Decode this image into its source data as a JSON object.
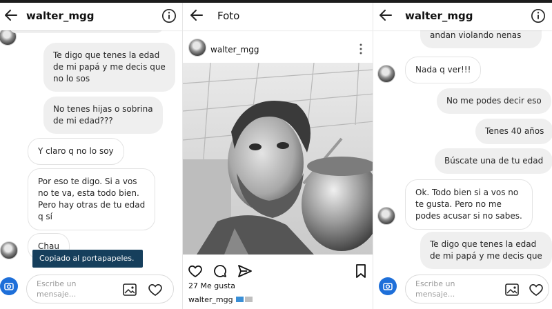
{
  "left_chat": {
    "title": "walter_mgg",
    "messages": [
      "Te digo que tenes la edad\nde mi papá y me decis que\nno lo sos",
      "No tenes hijas o sobrina\nde mi edad???",
      "Y claro q no lo soy",
      "Por eso te digo. Si a vos\nno te va, esta todo bien.\nPero hay otras de tu edad\nq sí",
      "Chau"
    ],
    "toast": "Copiado al portapapeles.",
    "composer_placeholder": "Escribe un\nmensaje..."
  },
  "post": {
    "title": "Foto",
    "username": "walter_mgg",
    "likes": "27 Me gusta",
    "caption_user": "walter_mgg"
  },
  "right_chat": {
    "title": "walter_mgg",
    "messages": [
      "Y pos como vos después\nandan violando nenas",
      "Nada q ver!!!",
      "No me podes decir eso",
      "Tenes 40 años",
      "Búscate una de tu edad",
      "Ok. Todo bien si a vos no\nte gusta. Pero no me\npodes acusar si no sabes.",
      "Te digo que tenes la edad\nde mi papá y me decis que"
    ],
    "composer_placeholder": "Escribe un\nmensaje..."
  },
  "colors": {
    "toast_bg": "#163f5c",
    "camera_button": "#1e6fd9",
    "bubble_sent": "#efefef",
    "bubble_received_border": "#e3e3e3"
  },
  "icons": [
    "back-arrow-icon",
    "info-icon",
    "camera-icon",
    "gallery-icon",
    "heart-icon",
    "comment-icon",
    "share-icon",
    "bookmark-icon",
    "more-icon"
  ]
}
